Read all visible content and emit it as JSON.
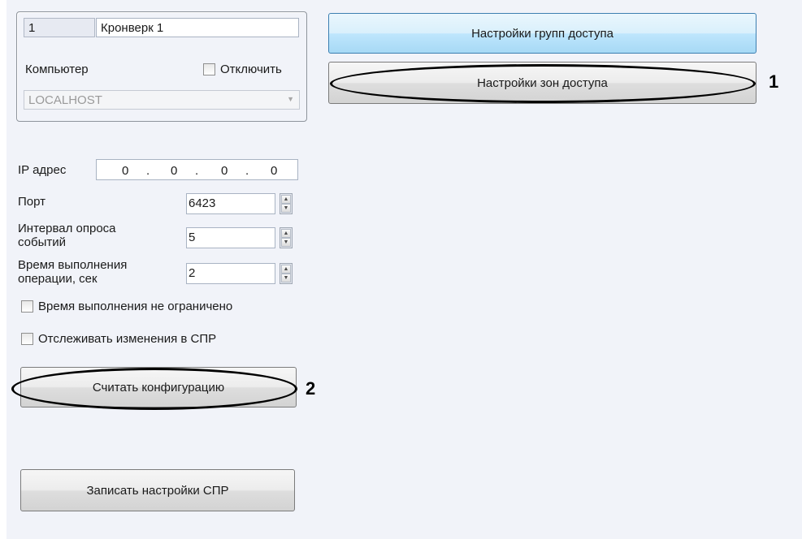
{
  "device": {
    "id_value": "1",
    "name_value": "Кронверк 1",
    "computer_label": "Компьютер",
    "disable_label": "Отключить",
    "computer_value": "LOCALHOST"
  },
  "network": {
    "ip_label": "IP адрес",
    "ip_octets": [
      "0",
      "0",
      "0",
      "0"
    ],
    "ip_dot": ".",
    "port_label": "Порт",
    "port_value": "6423",
    "poll_label_line1": "Интервал опроса",
    "poll_label_line2": "событий",
    "poll_value": "5",
    "timeout_label_line1": "Время выполнения",
    "timeout_label_line2": "операции, сек",
    "timeout_value": "2",
    "unlimited_label": "Время выполнения не ограничено",
    "track_label": "Отслеживать изменения в СПР"
  },
  "buttons": {
    "read_config": "Считать конфигурацию",
    "write_settings": "Записать настройки СПР",
    "group_settings": "Настройки групп доступа",
    "zone_settings": "Настройки зон доступа"
  },
  "callouts": {
    "one": "1",
    "two": "2"
  },
  "spin_up_glyph": "▲",
  "spin_down_glyph": "▼",
  "dropdown_glyph": "▼",
  "colors": {
    "panel_bg": "#f1f3f9",
    "hot_button": "#bee6fd",
    "highlight_oval": "#000000"
  }
}
